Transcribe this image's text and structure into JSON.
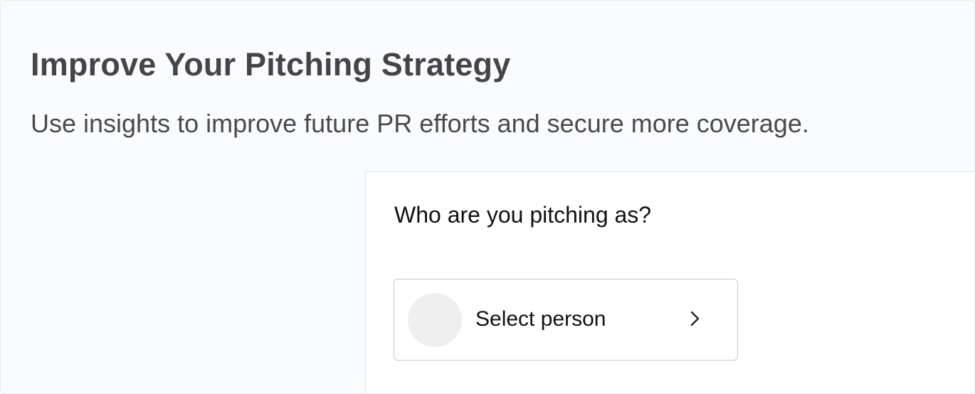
{
  "header": {
    "title": "Improve Your Pitching Strategy",
    "subtitle": "Use insights to improve future PR efforts and secure more coverage."
  },
  "panel": {
    "question": "Who are you pitching as?",
    "person_selector": {
      "label": "Select person",
      "avatar_color": "#efefef",
      "trailing_icon": "chevron-right-icon"
    }
  },
  "colors": {
    "page_background": "#fafbff",
    "panel_background": "#ffffff",
    "title_text": "#454545",
    "body_text": "#111111"
  }
}
